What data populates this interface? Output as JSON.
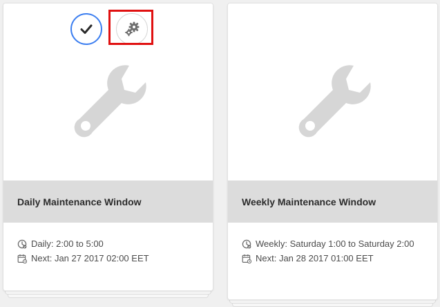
{
  "cards": [
    {
      "title": "Daily Maintenance Window",
      "schedule": "Daily: 2:00 to 5:00",
      "next": "Next: Jan 27 2017 02:00 EET",
      "selected": true,
      "icon": "wrench-icon"
    },
    {
      "title": "Weekly Maintenance Window",
      "schedule": "Weekly: Saturday 1:00 to Saturday 2:00",
      "next": "Next: Jan 28 2017 01:00 EET",
      "selected": false,
      "icon": "wrench-icon"
    }
  ],
  "actions": {
    "select_icon": "checkmark-icon",
    "settings_icon": "gears-icon",
    "highlighted": "settings-button"
  },
  "colors": {
    "background": "#f0f0f0",
    "title_bar": "#dcdcdc",
    "wrench": "#d6d6d6",
    "accent_blue": "#3d7ff0",
    "highlight_red": "#e01010"
  }
}
